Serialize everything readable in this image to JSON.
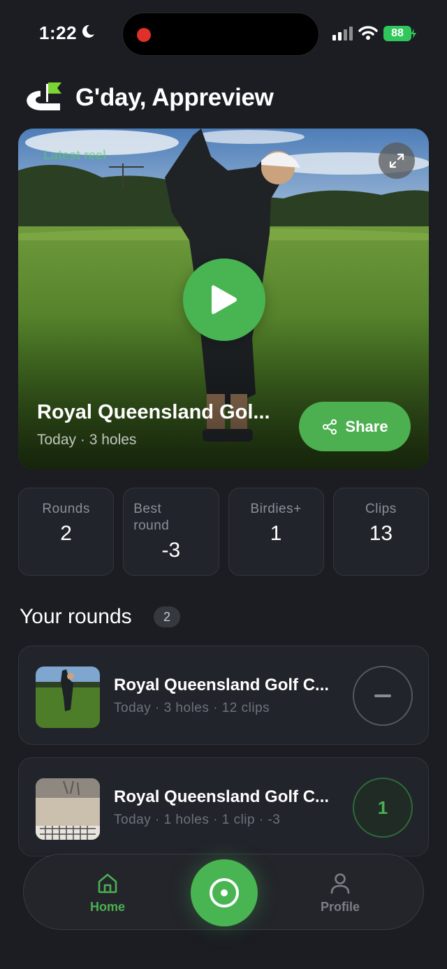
{
  "status_bar": {
    "time": "1:22",
    "battery": "88",
    "icons": [
      "moon-icon",
      "recording-dot-icon",
      "signal-icon",
      "wifi-icon",
      "battery-icon",
      "charging-bolt-icon"
    ]
  },
  "header": {
    "greeting": "G'day, Appreview",
    "logo_icon": "golf-flag-logo-icon"
  },
  "hero": {
    "tag": "Latest reel",
    "title": "Royal Queensland Gol...",
    "subtitle": "Today · 3 holes",
    "share_label": "Share",
    "expand_icon": "expand-icon",
    "play_icon": "play-icon",
    "share_icon": "share-icon"
  },
  "stats": [
    {
      "label": "Rounds",
      "value": "2"
    },
    {
      "label": "Best round",
      "value": "-3"
    },
    {
      "label": "Birdies+",
      "value": "1"
    },
    {
      "label": "Clips",
      "value": "13"
    }
  ],
  "rounds": {
    "title": "Your rounds",
    "count": "2",
    "items": [
      {
        "title": "Royal Queensland Golf C...",
        "meta": "Today · 3 holes · 12 clips",
        "score": ""
      },
      {
        "title": "Royal Queensland Golf C...",
        "meta": "Today · 1 holes · 1 clip · -3",
        "score": "1"
      }
    ]
  },
  "nav": {
    "home_label": "Home",
    "profile_label": "Profile",
    "home_icon": "home-icon",
    "record_icon": "record-icon",
    "profile_icon": "profile-icon"
  },
  "colors": {
    "background": "#1b1d23",
    "accent": "#49b552",
    "card": "#22242b",
    "muted_text": "#8c8f98"
  }
}
